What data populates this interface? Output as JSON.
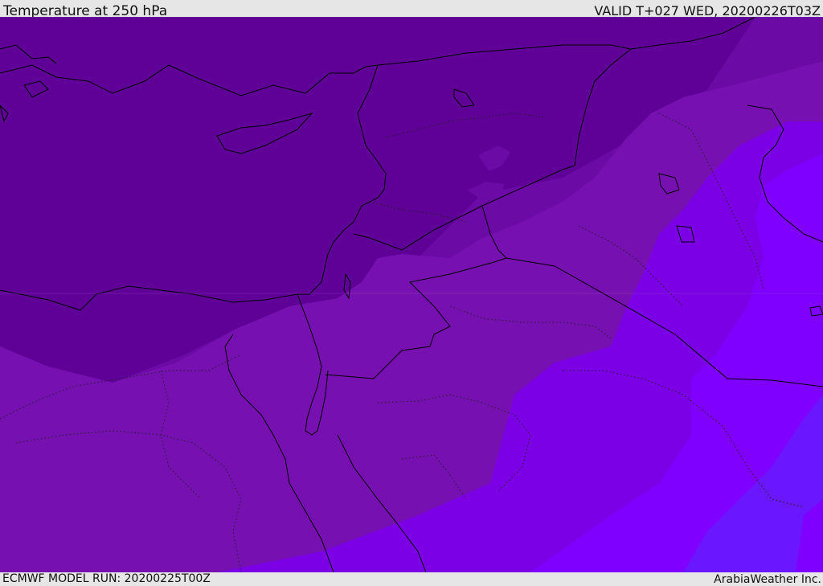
{
  "header": {
    "title": "Temperature at 250 hPa",
    "valid_time": "VALID T+027 WED, 20200226T03Z"
  },
  "footer": {
    "model_run": "ECMWF MODEL RUN: 20200225T00Z",
    "credit": "ArabiaWeather Inc."
  },
  "map": {
    "field": "temperature",
    "level": "250 hPa",
    "region": "Eastern Mediterranean, Levant, Egypt, Arabia",
    "colors": {
      "coldest": "#5f0096",
      "cold": "#6b0aa4",
      "mid": "#7710b0",
      "warm": "#7b00e6",
      "warmer": "#8000ff",
      "warmest": "#6a16ff"
    },
    "layers": [
      "coastlines",
      "country-borders",
      "region-borders-dotted"
    ]
  }
}
